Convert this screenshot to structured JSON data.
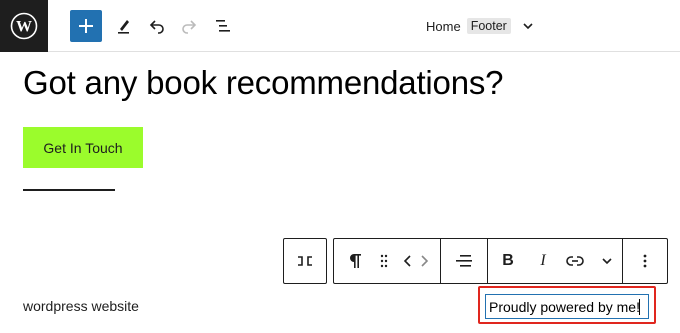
{
  "header": {
    "logo_icon": "wordpress-logo",
    "add_icon": "plus-icon",
    "tools_icon": "pen-icon",
    "undo_icon": "undo-icon",
    "redo_icon": "redo-icon",
    "list_view_icon": "list-view-icon",
    "breadcrumb_home": "Home",
    "breadcrumb_template": "Footer",
    "accent_color": "#2271b1"
  },
  "content": {
    "heading": "Got any book recommendations?",
    "cta_label": "Get In Touch",
    "cta_color": "#9bfc2c"
  },
  "block_toolbar": {
    "transform_icon": "block-transform-icon",
    "paragraph_icon": "pilcrow-icon",
    "drag_icon": "drag-handle-icon",
    "move_icon": "move-arrows-icon",
    "align_icon": "align-icon",
    "bold_label": "B",
    "italic_label": "I",
    "link_icon": "link-icon",
    "more_formatting_icon": "chevron-down-icon",
    "options_icon": "more-vertical-icon"
  },
  "footer": {
    "site_name": "wordpress website",
    "credit_text": "Proudly powered by me!",
    "highlight_color": "#e0261e"
  }
}
